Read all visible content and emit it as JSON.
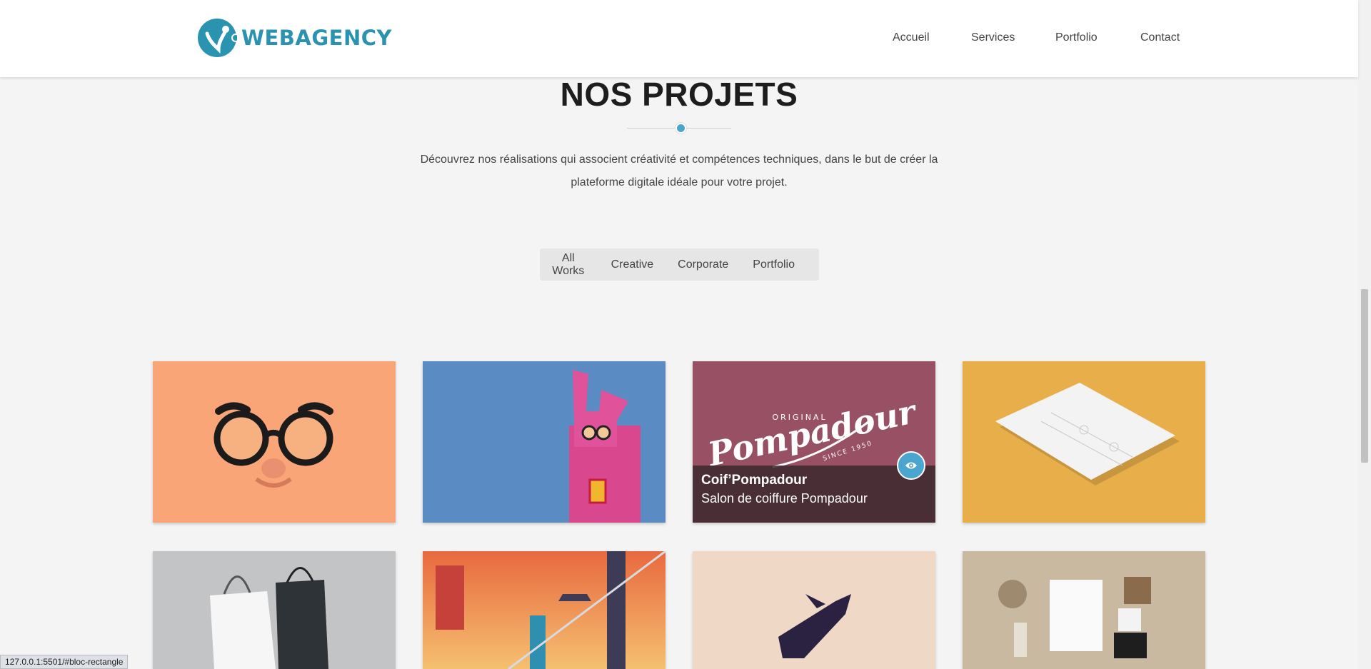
{
  "header": {
    "logo_text": "WEBAGENCY",
    "nav": [
      "Accueil",
      "Services",
      "Portfolio",
      "Contact"
    ]
  },
  "section": {
    "title": "NOS PROJETS",
    "intro": "Découvrez nos réalisations qui associent créativité et compétences techniques, dans le but de créer la plateforme digitale idéale pour votre projet."
  },
  "filters": [
    "All Works",
    "Creative",
    "Corporate",
    "Portfolio"
  ],
  "projects": [
    {
      "image": "funny-glasses-on-orange",
      "bg": "#f9a577"
    },
    {
      "image": "pink-rabbit-costume-on-blue",
      "bg": "#5a8bc2"
    },
    {
      "image": "pompadour-logo-on-mauve",
      "bg": "#985065",
      "overlay_title": "Coif’Pompadour",
      "overlay_subtitle": "Salon de coiffure Pompadour"
    },
    {
      "image": "paper-sheet-on-yellow",
      "bg": "#e8ae49"
    },
    {
      "image": "shopping-bags-on-grey",
      "bg": "#c3c4c6"
    },
    {
      "image": "city-sunset-illustration",
      "bg": "#ee9a55"
    },
    {
      "image": "rocket-illustration-on-beige",
      "bg": "#efd8c6"
    },
    {
      "image": "stationery-mockup-on-tan",
      "bg": "#cab9a1"
    }
  ],
  "pompadour_logo": {
    "top": "ORIGINAL",
    "script": "Pompadour",
    "bottom": "SINCE 1950"
  },
  "status_bar": "127.0.0.1:5501/#bloc-rectangle",
  "colors": {
    "accent": "#4aa5cf",
    "logo": "#2a93b0"
  }
}
